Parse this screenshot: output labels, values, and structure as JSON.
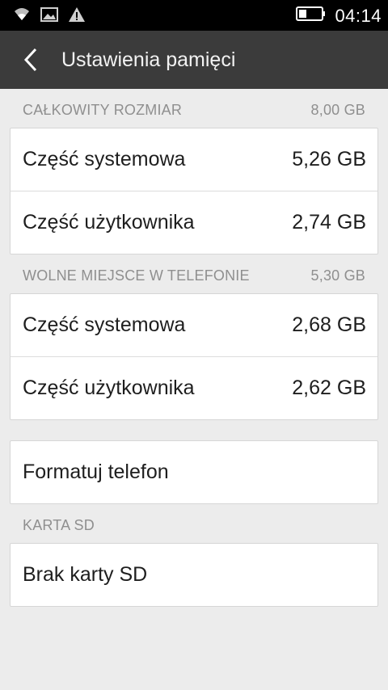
{
  "status_bar": {
    "time": "04:14",
    "icons": [
      "wifi-icon",
      "image-icon",
      "warning-icon",
      "battery-icon"
    ]
  },
  "action_bar": {
    "title": "Ustawienia pamięci",
    "back_icon": "chevron-left-icon"
  },
  "sections": {
    "total": {
      "header": "CAŁKOWITY ROZMIAR",
      "value": "8,00 GB",
      "rows": [
        {
          "label": "Część systemowa",
          "value": "5,26 GB"
        },
        {
          "label": "Część użytkownika",
          "value": "2,74 GB"
        }
      ]
    },
    "free": {
      "header": "WOLNE MIEJSCE W TELEFONIE",
      "value": "5,30 GB",
      "rows": [
        {
          "label": "Część systemowa",
          "value": "2,68 GB"
        },
        {
          "label": "Część użytkownika",
          "value": "2,62 GB"
        }
      ]
    },
    "format": {
      "label": "Formatuj telefon"
    },
    "sd": {
      "header": "KARTA SD",
      "row_label": "Brak karty SD"
    }
  },
  "colors": {
    "status_bar": "#000000",
    "action_bar": "#3b3b3b",
    "background": "#ececec",
    "header_text": "#8f8f8f"
  }
}
